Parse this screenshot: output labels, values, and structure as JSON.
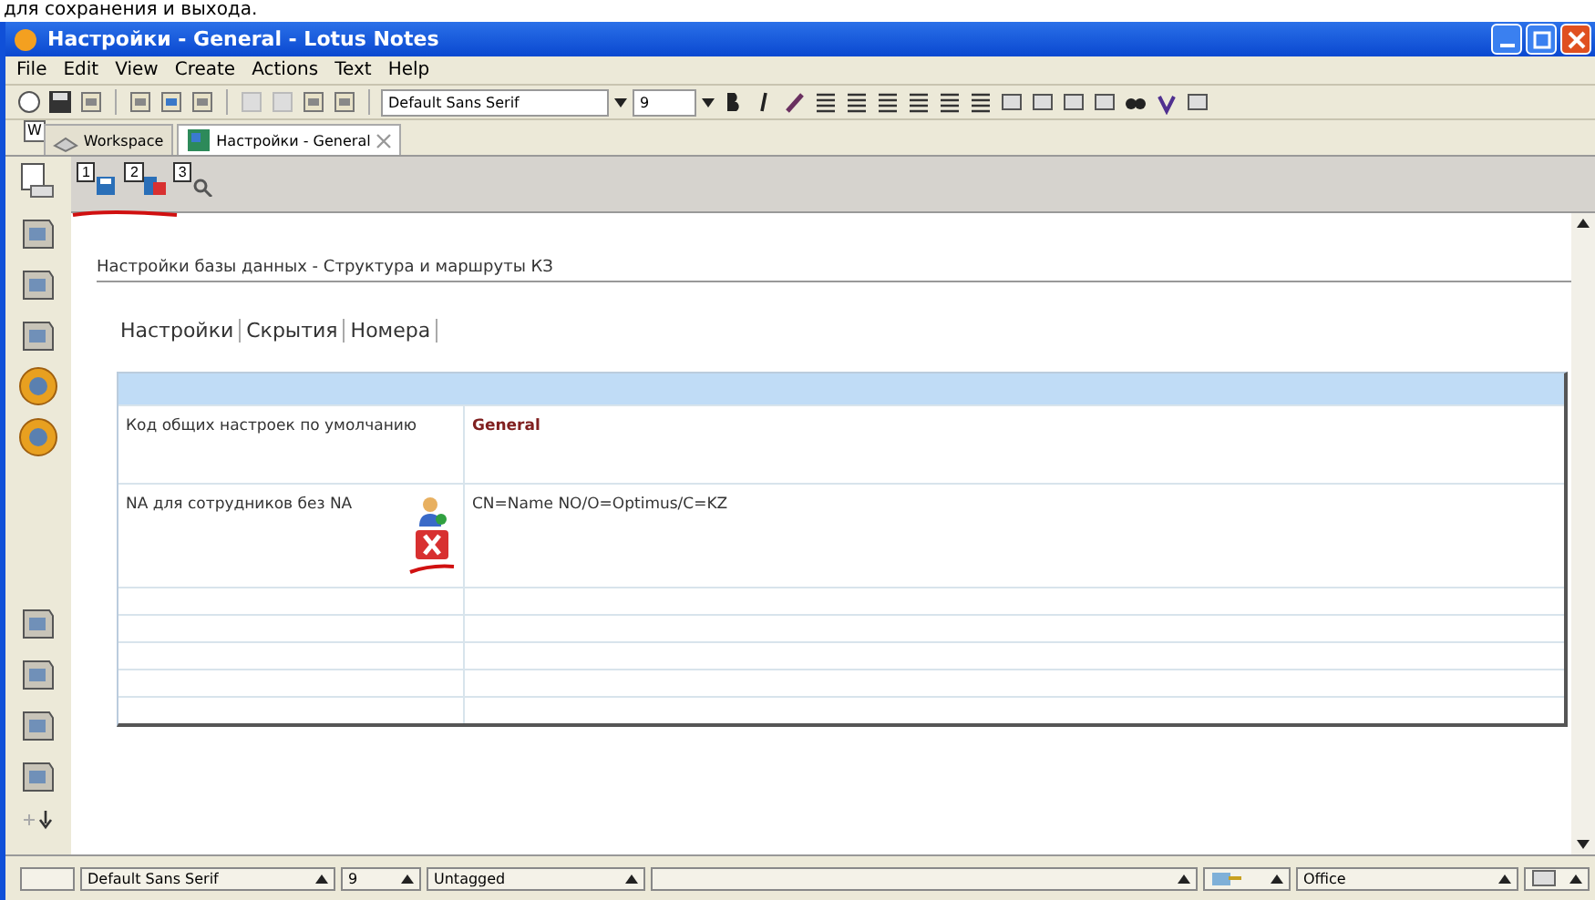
{
  "caption": "для сохранения и выхода.",
  "window": {
    "title": "Настройки - General - Lotus Notes"
  },
  "menu": [
    "File",
    "Edit",
    "View",
    "Create",
    "Actions",
    "Text",
    "Help"
  ],
  "toolbar": {
    "font": "Default Sans Serif",
    "size": "9"
  },
  "tabs": [
    {
      "label": "Workspace",
      "selected": false,
      "badge": "W"
    },
    {
      "label": "Настройки - General",
      "selected": true
    }
  ],
  "actions": [
    {
      "number": "1",
      "kind": "save"
    },
    {
      "number": "2",
      "kind": "close"
    },
    {
      "number": "3",
      "kind": "search"
    }
  ],
  "breadcrumb": "Настройки базы данных - Структура и маршруты КЗ",
  "form_tabs": [
    "Настройки",
    "Скрытия",
    "Номера"
  ],
  "table": {
    "rows": [
      {
        "label": "Код общих настроек по умолчанию",
        "value": "General",
        "kind": "text"
      },
      {
        "label": "NA для сотрудников без NA",
        "value": "CN=Name NO/O=Optimus/C=KZ",
        "kind": "names"
      }
    ]
  },
  "status_bar": {
    "font": "Default Sans Serif",
    "size": "9",
    "tag": "Untagged",
    "location": "Office"
  }
}
